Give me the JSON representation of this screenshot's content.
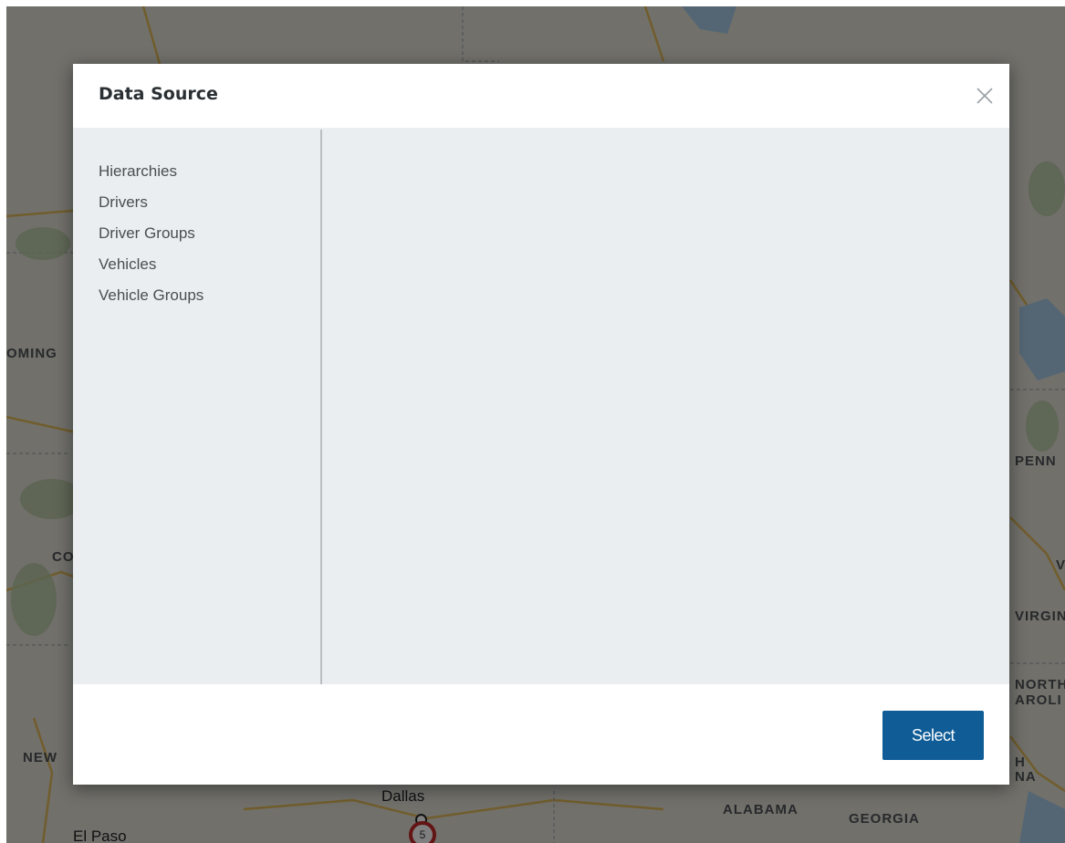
{
  "map": {
    "state_labels": {
      "wyoming": "OMING",
      "colorado": "CO",
      "new_mexico": "NEW",
      "pennsylvania": "PENN",
      "virginia": "VIRGIN",
      "north_carolina_1": "NORTH",
      "north_carolina_2": "AROLI",
      "alabama": "ALABAMA",
      "georgia": "GEORGIA",
      "w_fragment": "V",
      "h_fragment": "H",
      "na_fragment": "NA"
    },
    "city_labels": {
      "dallas": "Dallas",
      "el_paso": "El Paso"
    },
    "cluster_marker": {
      "count": "5",
      "ring_color": "#c62828"
    }
  },
  "modal": {
    "title": "Data Source",
    "close_icon": "close-icon",
    "sidebar": {
      "items": [
        {
          "label": "Hierarchies"
        },
        {
          "label": "Drivers"
        },
        {
          "label": "Driver Groups"
        },
        {
          "label": "Vehicles"
        },
        {
          "label": "Vehicle Groups"
        }
      ]
    },
    "footer": {
      "select_label": "Select"
    }
  },
  "colors": {
    "primary_button": "#0f5c96",
    "body_background": "#ebeef0",
    "overlay": "rgba(0,0,0,0.5)"
  }
}
